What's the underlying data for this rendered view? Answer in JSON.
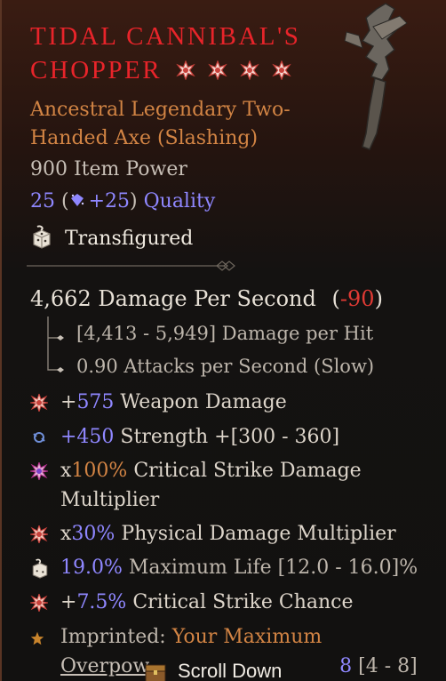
{
  "item": {
    "name": "TIDAL CANNIBAL'S CHOPPER",
    "name_line1": "TIDAL CANNIBAL'S",
    "name_line2": "CHOPPER",
    "type_line1": "Ancestral Legendary Two-",
    "type_line2": "Handed Axe (Slashing)",
    "item_power": "900 Item Power",
    "quality_value": "25",
    "quality_open": " (",
    "quality_bonus": "+25",
    "quality_close": ")",
    "quality_label": "Quality",
    "transfigured": "Transfigured"
  },
  "dps": {
    "value": "4,662 Damage Per Second",
    "delta_open": "(",
    "delta": "-90",
    "delta_close": ")",
    "per_hit": "[4,413 - 5,949] Damage per Hit",
    "attacks": "0.90 Attacks per Second (Slow)"
  },
  "affixes": [
    {
      "icon": "damage-icon",
      "prefix": "+",
      "value": "575",
      "text": " Weapon Damage"
    },
    {
      "icon": "strength-icon",
      "prefix": "",
      "value": "+450",
      "text": " Strength +[300 - 360]"
    },
    {
      "icon": "crit-damage-icon",
      "prefix": "x",
      "value": "100%",
      "text": " Critical Strike Damage Multiplier"
    },
    {
      "icon": "damage-icon",
      "prefix": "x",
      "value": "30%",
      "text": " Physical Damage Multiplier"
    },
    {
      "icon": "transfigured-icon",
      "prefix": "",
      "value": "19.0%",
      "text": " Maximum Life [12.0 - 16.0]%"
    },
    {
      "icon": "damage-icon",
      "prefix": "+",
      "value": "7.5%",
      "text": " Critical Strike Chance"
    }
  ],
  "imprint": {
    "label": "Imprinted:",
    "text_a": " Your Maximum",
    "text_b": "Overpow",
    "value": "8",
    "range": " [4 - 8]"
  },
  "scroll": {
    "label": "Scroll Down"
  },
  "colors": {
    "title": "#e8242a",
    "type": "#d28444",
    "stat_blue": "#8f87ff",
    "negative": "#e03a34"
  },
  "sockets": 4
}
